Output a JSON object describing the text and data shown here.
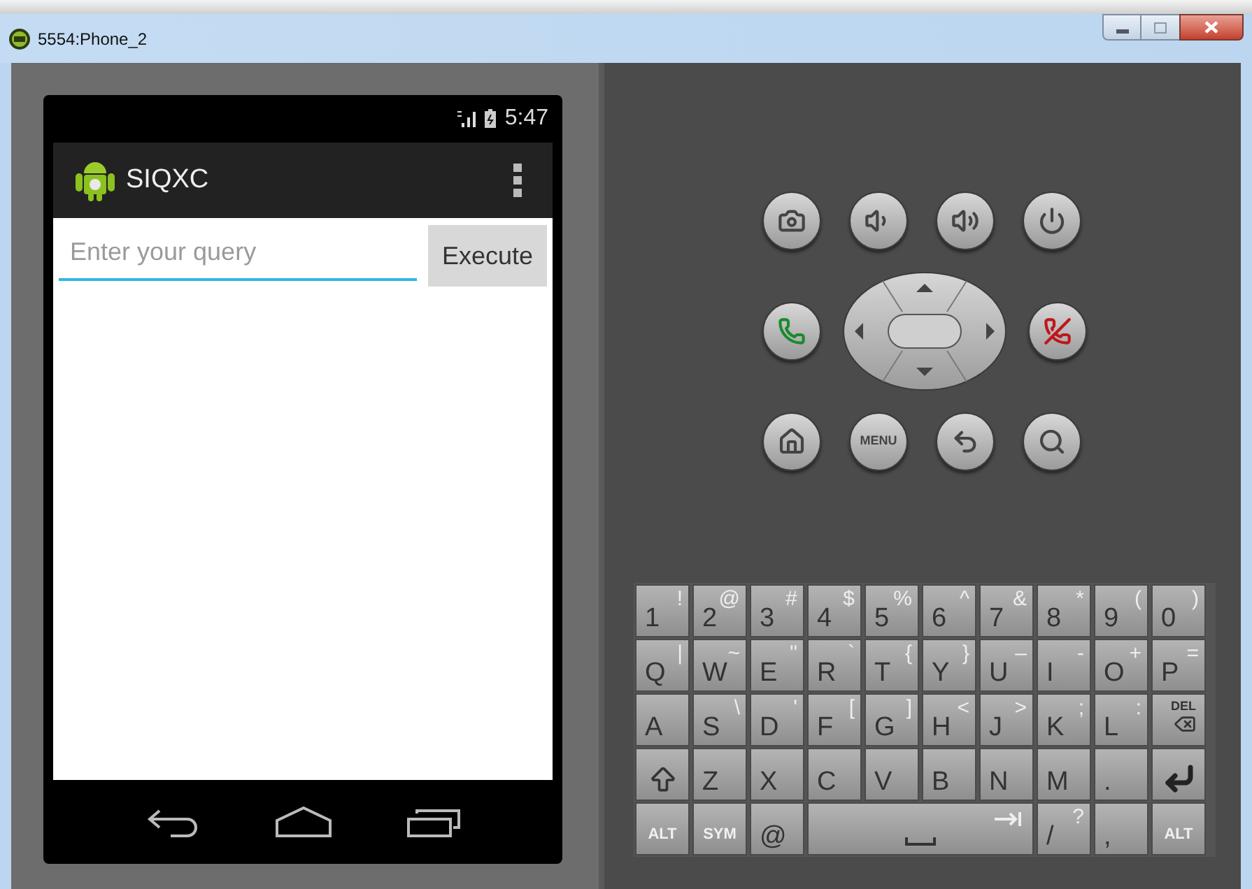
{
  "window": {
    "title": "5554:Phone_2"
  },
  "phone": {
    "status_time": "5:47",
    "app_title": "SIQXC",
    "query": {
      "placeholder": "Enter your query"
    },
    "execute_button": "Execute"
  },
  "hardware_buttons": [
    [
      {
        "kind": "camera"
      },
      {
        "kind": "volume-down"
      },
      {
        "kind": "volume-up"
      },
      {
        "kind": "power"
      }
    ],
    [
      {
        "kind": "call"
      },
      {
        "kind": "dpad"
      },
      {
        "kind": "hangup"
      }
    ],
    [
      {
        "kind": "home"
      },
      {
        "kind": "menu",
        "label": "MENU"
      },
      {
        "kind": "back"
      },
      {
        "kind": "search"
      }
    ]
  ],
  "keyboard": {
    "rows": [
      [
        {
          "kind": "char",
          "main": "1",
          "alt": "!"
        },
        {
          "kind": "char",
          "main": "2",
          "alt": "@"
        },
        {
          "kind": "char",
          "main": "3",
          "alt": "#"
        },
        {
          "kind": "char",
          "main": "4",
          "alt": "$"
        },
        {
          "kind": "char",
          "main": "5",
          "alt": "%"
        },
        {
          "kind": "char",
          "main": "6",
          "alt": "^"
        },
        {
          "kind": "char",
          "main": "7",
          "alt": "&"
        },
        {
          "kind": "char",
          "main": "8",
          "alt": "*"
        },
        {
          "kind": "char",
          "main": "9",
          "alt": "("
        },
        {
          "kind": "char",
          "main": "0",
          "alt": ")"
        }
      ],
      [
        {
          "kind": "char",
          "main": "Q",
          "alt": "|"
        },
        {
          "kind": "char",
          "main": "W",
          "alt": "~"
        },
        {
          "kind": "char",
          "main": "E",
          "alt": "\""
        },
        {
          "kind": "char",
          "main": "R",
          "alt": "`"
        },
        {
          "kind": "char",
          "main": "T",
          "alt": "{"
        },
        {
          "kind": "char",
          "main": "Y",
          "alt": "}"
        },
        {
          "kind": "char",
          "main": "U",
          "alt": "–"
        },
        {
          "kind": "char",
          "main": "I",
          "alt": "-"
        },
        {
          "kind": "char",
          "main": "O",
          "alt": "+"
        },
        {
          "kind": "char",
          "main": "P",
          "alt": "="
        }
      ],
      [
        {
          "kind": "char",
          "main": "A"
        },
        {
          "kind": "char",
          "main": "S",
          "alt": "\\"
        },
        {
          "kind": "char",
          "main": "D",
          "alt": "'"
        },
        {
          "kind": "char",
          "main": "F",
          "alt": "["
        },
        {
          "kind": "char",
          "main": "G",
          "alt": "]"
        },
        {
          "kind": "char",
          "main": "H",
          "alt": "<"
        },
        {
          "kind": "char",
          "main": "J",
          "alt": ">"
        },
        {
          "kind": "char",
          "main": "K",
          "alt": ";"
        },
        {
          "kind": "char",
          "main": "L",
          "alt": ":"
        },
        {
          "kind": "delete",
          "label": "DEL"
        }
      ],
      [
        {
          "kind": "shift"
        },
        {
          "kind": "char",
          "main": "Z"
        },
        {
          "kind": "char",
          "main": "X"
        },
        {
          "kind": "char",
          "main": "C"
        },
        {
          "kind": "char",
          "main": "V"
        },
        {
          "kind": "char",
          "main": "B"
        },
        {
          "kind": "char",
          "main": "N"
        },
        {
          "kind": "char",
          "main": "M"
        },
        {
          "kind": "char",
          "main": "."
        },
        {
          "kind": "enter"
        }
      ]
    ],
    "bottom_row": {
      "left_keys": [
        {
          "kind": "modifier",
          "label": "ALT"
        },
        {
          "kind": "modifier",
          "label": "SYM"
        },
        {
          "kind": "char",
          "main": "@"
        }
      ],
      "space_bar": {
        "kind": "space"
      },
      "right_keys": [
        {
          "kind": "char",
          "main": "/",
          "alt": "?"
        },
        {
          "kind": "char",
          "main": ","
        },
        {
          "kind": "modifier",
          "label": "ALT"
        }
      ]
    }
  }
}
